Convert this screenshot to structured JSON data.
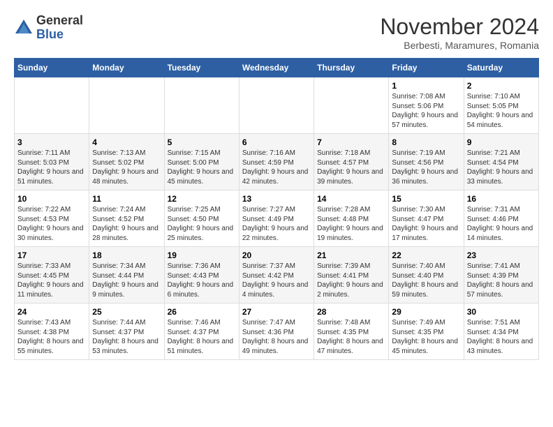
{
  "logo": {
    "general": "General",
    "blue": "Blue"
  },
  "title": "November 2024",
  "subtitle": "Berbesti, Maramures, Romania",
  "weekdays": [
    "Sunday",
    "Monday",
    "Tuesday",
    "Wednesday",
    "Thursday",
    "Friday",
    "Saturday"
  ],
  "weeks": [
    [
      {
        "day": "",
        "details": ""
      },
      {
        "day": "",
        "details": ""
      },
      {
        "day": "",
        "details": ""
      },
      {
        "day": "",
        "details": ""
      },
      {
        "day": "",
        "details": ""
      },
      {
        "day": "1",
        "details": "Sunrise: 7:08 AM\nSunset: 5:06 PM\nDaylight: 9 hours and 57 minutes."
      },
      {
        "day": "2",
        "details": "Sunrise: 7:10 AM\nSunset: 5:05 PM\nDaylight: 9 hours and 54 minutes."
      }
    ],
    [
      {
        "day": "3",
        "details": "Sunrise: 7:11 AM\nSunset: 5:03 PM\nDaylight: 9 hours and 51 minutes."
      },
      {
        "day": "4",
        "details": "Sunrise: 7:13 AM\nSunset: 5:02 PM\nDaylight: 9 hours and 48 minutes."
      },
      {
        "day": "5",
        "details": "Sunrise: 7:15 AM\nSunset: 5:00 PM\nDaylight: 9 hours and 45 minutes."
      },
      {
        "day": "6",
        "details": "Sunrise: 7:16 AM\nSunset: 4:59 PM\nDaylight: 9 hours and 42 minutes."
      },
      {
        "day": "7",
        "details": "Sunrise: 7:18 AM\nSunset: 4:57 PM\nDaylight: 9 hours and 39 minutes."
      },
      {
        "day": "8",
        "details": "Sunrise: 7:19 AM\nSunset: 4:56 PM\nDaylight: 9 hours and 36 minutes."
      },
      {
        "day": "9",
        "details": "Sunrise: 7:21 AM\nSunset: 4:54 PM\nDaylight: 9 hours and 33 minutes."
      }
    ],
    [
      {
        "day": "10",
        "details": "Sunrise: 7:22 AM\nSunset: 4:53 PM\nDaylight: 9 hours and 30 minutes."
      },
      {
        "day": "11",
        "details": "Sunrise: 7:24 AM\nSunset: 4:52 PM\nDaylight: 9 hours and 28 minutes."
      },
      {
        "day": "12",
        "details": "Sunrise: 7:25 AM\nSunset: 4:50 PM\nDaylight: 9 hours and 25 minutes."
      },
      {
        "day": "13",
        "details": "Sunrise: 7:27 AM\nSunset: 4:49 PM\nDaylight: 9 hours and 22 minutes."
      },
      {
        "day": "14",
        "details": "Sunrise: 7:28 AM\nSunset: 4:48 PM\nDaylight: 9 hours and 19 minutes."
      },
      {
        "day": "15",
        "details": "Sunrise: 7:30 AM\nSunset: 4:47 PM\nDaylight: 9 hours and 17 minutes."
      },
      {
        "day": "16",
        "details": "Sunrise: 7:31 AM\nSunset: 4:46 PM\nDaylight: 9 hours and 14 minutes."
      }
    ],
    [
      {
        "day": "17",
        "details": "Sunrise: 7:33 AM\nSunset: 4:45 PM\nDaylight: 9 hours and 11 minutes."
      },
      {
        "day": "18",
        "details": "Sunrise: 7:34 AM\nSunset: 4:44 PM\nDaylight: 9 hours and 9 minutes."
      },
      {
        "day": "19",
        "details": "Sunrise: 7:36 AM\nSunset: 4:43 PM\nDaylight: 9 hours and 6 minutes."
      },
      {
        "day": "20",
        "details": "Sunrise: 7:37 AM\nSunset: 4:42 PM\nDaylight: 9 hours and 4 minutes."
      },
      {
        "day": "21",
        "details": "Sunrise: 7:39 AM\nSunset: 4:41 PM\nDaylight: 9 hours and 2 minutes."
      },
      {
        "day": "22",
        "details": "Sunrise: 7:40 AM\nSunset: 4:40 PM\nDaylight: 8 hours and 59 minutes."
      },
      {
        "day": "23",
        "details": "Sunrise: 7:41 AM\nSunset: 4:39 PM\nDaylight: 8 hours and 57 minutes."
      }
    ],
    [
      {
        "day": "24",
        "details": "Sunrise: 7:43 AM\nSunset: 4:38 PM\nDaylight: 8 hours and 55 minutes."
      },
      {
        "day": "25",
        "details": "Sunrise: 7:44 AM\nSunset: 4:37 PM\nDaylight: 8 hours and 53 minutes."
      },
      {
        "day": "26",
        "details": "Sunrise: 7:46 AM\nSunset: 4:37 PM\nDaylight: 8 hours and 51 minutes."
      },
      {
        "day": "27",
        "details": "Sunrise: 7:47 AM\nSunset: 4:36 PM\nDaylight: 8 hours and 49 minutes."
      },
      {
        "day": "28",
        "details": "Sunrise: 7:48 AM\nSunset: 4:35 PM\nDaylight: 8 hours and 47 minutes."
      },
      {
        "day": "29",
        "details": "Sunrise: 7:49 AM\nSunset: 4:35 PM\nDaylight: 8 hours and 45 minutes."
      },
      {
        "day": "30",
        "details": "Sunrise: 7:51 AM\nSunset: 4:34 PM\nDaylight: 8 hours and 43 minutes."
      }
    ]
  ]
}
